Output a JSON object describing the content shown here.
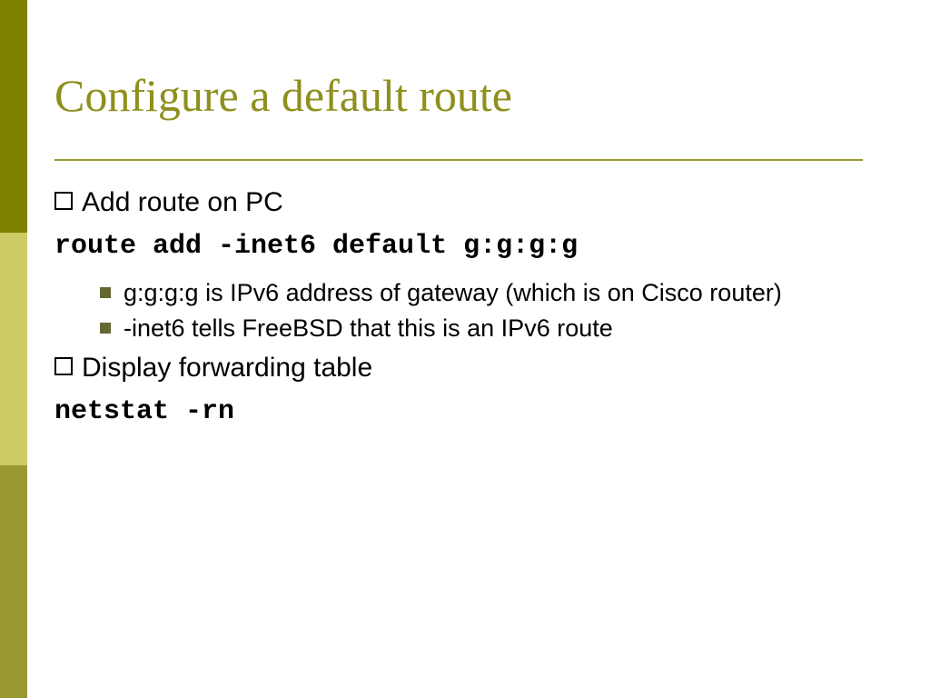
{
  "title": "Configure a default route",
  "body": {
    "item1": "Add route on PC",
    "cmd1": "route add -inet6 default g:g:g:g",
    "sub1a": "g:g:g:g is IPv6 address of gateway (which is on Cisco router)",
    "sub1b": "-inet6 tells FreeBSD that this is an IPv6 route",
    "item2": "Display forwarding table",
    "cmd2": "netstat -rn"
  }
}
